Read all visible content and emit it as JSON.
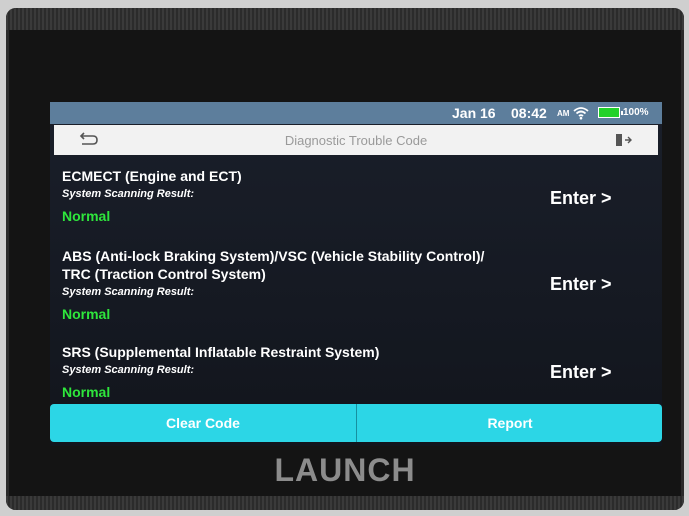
{
  "status": {
    "date": "Jan 16",
    "time": "08:42",
    "ampm": "AM",
    "battery": "100%"
  },
  "header": {
    "title": "Diagnostic Trouble Code"
  },
  "systems": [
    {
      "title_lines": [
        "ECMECT (Engine and ECT)"
      ],
      "subtitle": "System Scanning Result:",
      "status": "Normal",
      "enter": "Enter >"
    },
    {
      "title_lines": [
        "ABS (Anti-lock Braking System)/VSC (Vehicle Stability Control)/",
        "TRC (Traction Control System)"
      ],
      "subtitle": "System Scanning Result:",
      "status": "Normal",
      "enter": "Enter >"
    },
    {
      "title_lines": [
        "SRS (Supplemental Inflatable Restraint System)"
      ],
      "subtitle": "System Scanning Result:",
      "status": "Normal",
      "enter": "Enter >"
    }
  ],
  "actions": {
    "clear_code": "Clear Code",
    "report": "Report"
  },
  "device": {
    "brand": "LAUNCH"
  },
  "colors": {
    "statusbar": "#5d7e9c",
    "button_bar": "#2cd6e6",
    "normal_status": "#2ee63c"
  },
  "icons": {
    "back": "back-arrow-icon",
    "exit": "exit-icon",
    "wifi": "wifi-icon",
    "battery": "battery-icon"
  }
}
